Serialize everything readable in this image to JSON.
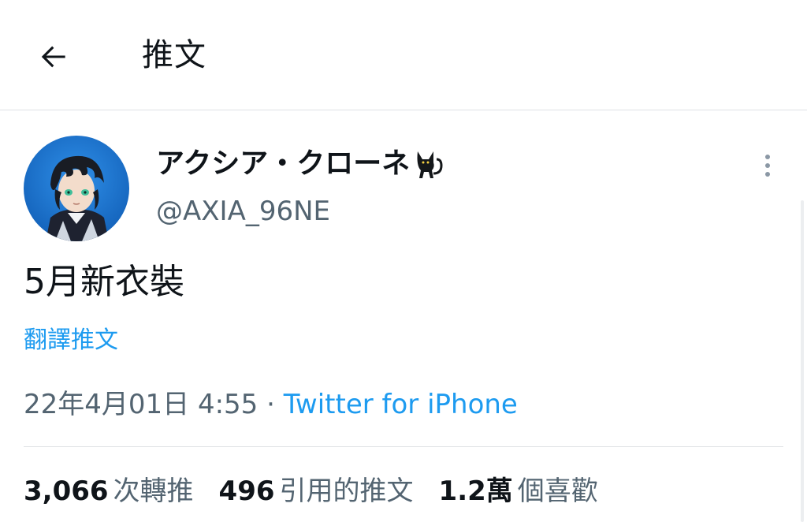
{
  "header": {
    "title": "推文",
    "back_icon": "arrow-left-icon"
  },
  "tweet": {
    "author": {
      "display_name": "アクシア・クローネ",
      "name_icon": "black-cat-icon",
      "handle": "@AXIA_96NE",
      "avatar_icon": "avatar-image"
    },
    "more_icon": "more-vertical-icon",
    "text": "5月新衣裝",
    "translate_label": "翻譯推文",
    "timestamp": "22年4月01日 4:55",
    "separator": " · ",
    "source": "Twitter for iPhone",
    "stats": {
      "retweets_count": "3,066",
      "retweets_label": "次轉推",
      "quotes_count": "496",
      "quotes_label": "引用的推文",
      "likes_count": "1.2萬",
      "likes_label": "個喜歡"
    }
  },
  "colors": {
    "accent": "#1d9bf0",
    "text_primary": "#0f1419",
    "text_secondary": "#536471",
    "divider": "#dfe2e5"
  }
}
